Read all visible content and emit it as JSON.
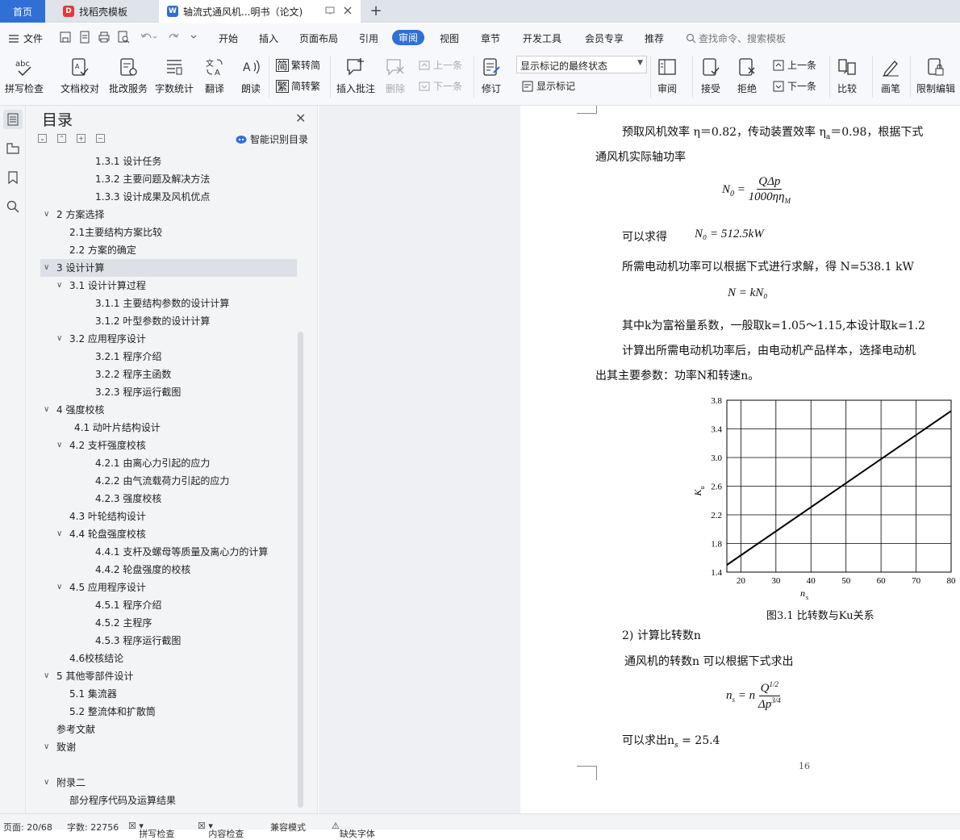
{
  "tabs": {
    "home": "首页",
    "template": "找稻壳模板",
    "document": "轴流式通风机...明书（论文)"
  },
  "menu": {
    "file": "文件",
    "items": [
      "开始",
      "插入",
      "页面布局",
      "引用",
      "审阅",
      "视图",
      "章节",
      "开发工具",
      "会员专享",
      "推荐"
    ],
    "active": "审阅",
    "search": "查找命令、搜索模板"
  },
  "ribbon": {
    "spell": "拼写检查",
    "proof": "文档校对",
    "batch": "批改服务",
    "wordcount": "字数统计",
    "translate": "翻译",
    "read": "朗读",
    "trad": "繁转简",
    "simp": "简转繁",
    "insert_comment": "插入批注",
    "delete": "删除",
    "prev_comment": "上一条",
    "next_comment": "下一条",
    "revise": "修订",
    "markup_state": "显示标记的最终状态",
    "show_markup": "显示标记",
    "review": "审阅",
    "accept": "接受",
    "reject": "拒绝",
    "prev_change": "上一条",
    "next_change": "下一条",
    "compare": "比较",
    "pen": "画笔",
    "restrict": "限制编辑"
  },
  "toc": {
    "title": "目录",
    "smart": "智能识别目录",
    "items": [
      "1.3.1  设计任务",
      "1.3.2  主要问题及解决方法",
      "1.3.3  设计成果及风机优点",
      "2  方案选择",
      "2.1主要结构方案比较",
      "2.2  方案的确定",
      "3  设计计算",
      "3.1  设计计算过程",
      "3.1.1  主要结构参数的设计计算",
      "3.1.2  叶型参数的设计计算",
      "3.2  应用程序设计",
      "3.2.1  程序介绍",
      "3.2.2  程序主函数",
      "3.2.3  程序运行截图",
      "4  强度校核",
      "4.1  动叶片结构设计",
      "4.2  支杆强度校核",
      "4.2.1  由离心力引起的应力",
      "4.2.2  由气流载荷力引起的应力",
      "4.2.3  强度校核",
      "4.3  叶轮结构设计",
      "4.4  轮盘强度校核",
      "4.4.1  支杆及螺母等质量及离心力的计算",
      "4.4.2  轮盘强度的校核",
      "4.5  应用程序设计",
      "4.5.1  程序介绍",
      "4.5.2  主程序",
      "4.5.3  程序运行截图",
      "4.6校核结论",
      "5  其他零部件设计",
      "5.1  集流器",
      "5.2  整流体和扩散筒",
      "参考文献",
      "致谢",
      "",
      "附录二",
      "部分程序代码及运算结果"
    ],
    "selected_index": 6
  },
  "doc": {
    "para1a": "预取风机效率 η＝0.82，传动装置效率 η",
    "para1b": "＝0.98，根据下式",
    "para1c": "通风机实际轴功率",
    "eq1_lhs": "N",
    "eq1_num": "QΔp",
    "eq1_den": "1000ηη",
    "para2": "可以求得",
    "eq2": "N₀ = 512.5kW",
    "para3": "所需电动机功率可以根据下式进行求解，得 N=538.1 kW",
    "eq3": "N = kN₀",
    "para4": "其中k为富裕量系数，一般取k=1.05～1.15,本设计取k=1.2",
    "para5": "计算出所需电动机功率后，由电动机产品样本，选择电动机",
    "para6": "出其主要参数：功率N和转速n。",
    "caption": "图3.1 比转数与Ku关系",
    "para7": "2)  计算比转数n",
    "para8": "通风机的转数n 可以根据下式求出",
    "eq4_lhs": "n",
    "eq4_num": "Q",
    "eq4_den": "Δp",
    "para9": "可以求出n",
    "para9b": " = 25.4",
    "page_number": "16"
  },
  "chart_data": {
    "type": "line",
    "title": "",
    "xlabel": "n_s",
    "ylabel": "K_u",
    "xticks": [
      20,
      30,
      40,
      50,
      60,
      70,
      80
    ],
    "yticks": [
      1.4,
      1.8,
      2.2,
      2.6,
      3.0,
      3.4,
      3.8
    ],
    "xlim": [
      16,
      80
    ],
    "ylim": [
      1.4,
      3.8
    ],
    "grid": true,
    "series": [
      {
        "x": [
          16,
          80
        ],
        "y": [
          1.5,
          3.65
        ]
      }
    ]
  },
  "status": {
    "page": "页面: 20/68",
    "words": "字数: 22756",
    "spell": "拼写检查",
    "content": "内容检查",
    "compat": "兼容模式",
    "font": "缺失字体"
  },
  "colors": {
    "accent": "#2f6fd6"
  }
}
